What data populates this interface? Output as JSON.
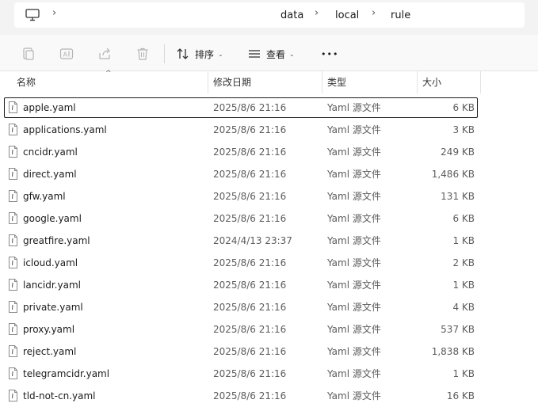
{
  "addressbar": {
    "icon": "this-pc-icon",
    "crumbs": [
      "data",
      "local",
      "rule"
    ]
  },
  "toolbar": {
    "copy_icon": "copy-icon",
    "rename_icon": "rename-icon",
    "share_icon": "share-icon",
    "delete_icon": "delete-icon",
    "sort_label": "排序",
    "view_label": "查看",
    "more_label": "•••"
  },
  "columns": {
    "name": "名称",
    "date": "修改日期",
    "type": "类型",
    "size": "大小"
  },
  "files": [
    {
      "name": "apple.yaml",
      "date": "2025/8/6 21:16",
      "type": "Yaml 源文件",
      "size": "6 KB",
      "selected": true
    },
    {
      "name": "applications.yaml",
      "date": "2025/8/6 21:16",
      "type": "Yaml 源文件",
      "size": "3 KB"
    },
    {
      "name": "cncidr.yaml",
      "date": "2025/8/6 21:16",
      "type": "Yaml 源文件",
      "size": "249 KB"
    },
    {
      "name": "direct.yaml",
      "date": "2025/8/6 21:16",
      "type": "Yaml 源文件",
      "size": "1,486 KB"
    },
    {
      "name": "gfw.yaml",
      "date": "2025/8/6 21:16",
      "type": "Yaml 源文件",
      "size": "131 KB"
    },
    {
      "name": "google.yaml",
      "date": "2025/8/6 21:16",
      "type": "Yaml 源文件",
      "size": "6 KB"
    },
    {
      "name": "greatfire.yaml",
      "date": "2024/4/13 23:37",
      "type": "Yaml 源文件",
      "size": "1 KB"
    },
    {
      "name": "icloud.yaml",
      "date": "2025/8/6 21:16",
      "type": "Yaml 源文件",
      "size": "2 KB"
    },
    {
      "name": "lancidr.yaml",
      "date": "2025/8/6 21:16",
      "type": "Yaml 源文件",
      "size": "1 KB"
    },
    {
      "name": "private.yaml",
      "date": "2025/8/6 21:16",
      "type": "Yaml 源文件",
      "size": "4 KB"
    },
    {
      "name": "proxy.yaml",
      "date": "2025/8/6 21:16",
      "type": "Yaml 源文件",
      "size": "537 KB"
    },
    {
      "name": "reject.yaml",
      "date": "2025/8/6 21:16",
      "type": "Yaml 源文件",
      "size": "1,838 KB"
    },
    {
      "name": "telegramcidr.yaml",
      "date": "2025/8/6 21:16",
      "type": "Yaml 源文件",
      "size": "1 KB"
    },
    {
      "name": "tld-not-cn.yaml",
      "date": "2025/8/6 21:16",
      "type": "Yaml 源文件",
      "size": "16 KB"
    }
  ]
}
